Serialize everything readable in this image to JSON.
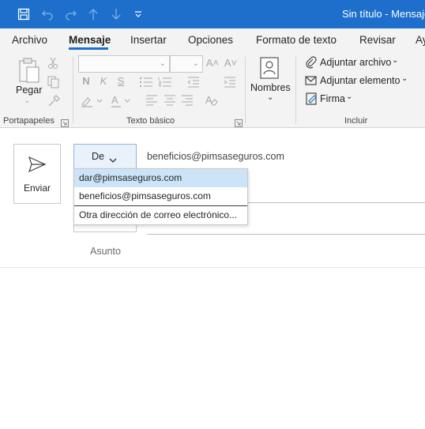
{
  "titlebar": {
    "title": "Sin título  -  Mensaje"
  },
  "tabs": [
    {
      "label": "Archivo"
    },
    {
      "label": "Mensaje"
    },
    {
      "label": "Insertar"
    },
    {
      "label": "Opciones"
    },
    {
      "label": "Formato de texto"
    },
    {
      "label": "Revisar"
    },
    {
      "label": "Ay"
    }
  ],
  "ribbon": {
    "clipboard": {
      "paste_label": "Pegar",
      "group_label": "Portapapeles"
    },
    "basic_text": {
      "bold": "N",
      "italic": "K",
      "underline": "S",
      "group_label": "Texto básico"
    },
    "names": {
      "label": "Nombres"
    },
    "include": {
      "attach_file": "Adjuntar archivo",
      "attach_item": "Adjuntar elemento",
      "signature": "Firma",
      "group_label": "Incluir"
    }
  },
  "compose": {
    "send_label": "Enviar",
    "from_label": "De",
    "from_value": "beneficios@pimsaseguros.com",
    "subject_placeholder": "Asunto",
    "from_options": [
      {
        "label": "dar@pimsaseguros.com"
      },
      {
        "label": "beneficios@pimsaseguros.com"
      },
      {
        "label": "Otra dirección de correo electrónico..."
      }
    ]
  },
  "colors": {
    "accent": "#1d6fcb",
    "selection": "#cce4f7"
  }
}
